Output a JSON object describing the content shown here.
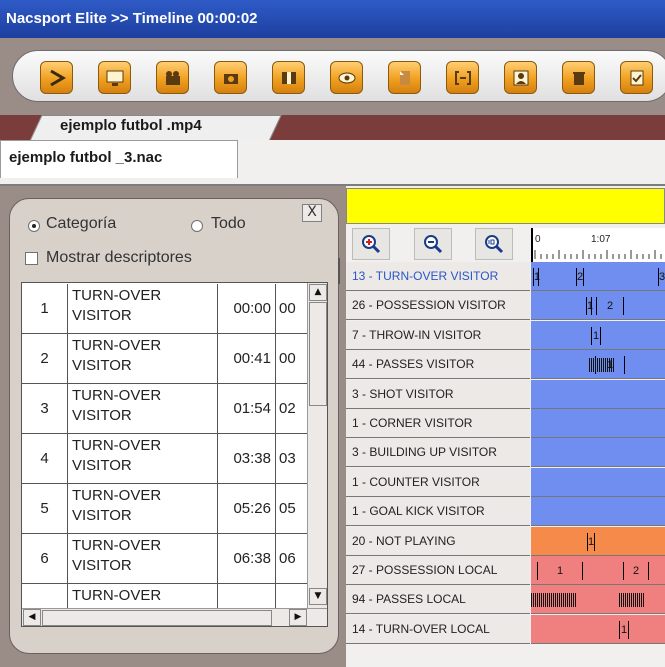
{
  "window": {
    "title": "Nacsport Elite  >>  Timeline 00:00:02"
  },
  "toolbar": {
    "buttons": [
      {
        "icon": "play-arrow-icon"
      },
      {
        "icon": "monitor-icon"
      },
      {
        "icon": "clapperboard-icon"
      },
      {
        "icon": "camera-icon"
      },
      {
        "icon": "film-strip-icon"
      },
      {
        "icon": "eye-icon"
      },
      {
        "icon": "page-icon"
      },
      {
        "icon": "bracket-icon"
      },
      {
        "icon": "image-person-icon"
      },
      {
        "icon": "trash-icon"
      },
      {
        "icon": "check-document-icon"
      }
    ],
    "colors": {
      "button": "#f0a020"
    }
  },
  "tabs": {
    "video": "ejemplo futbol .mp4",
    "project": "ejemplo futbol _3.nac"
  },
  "panel": {
    "close_label": "X",
    "option_category": "Categoría",
    "option_all": "Todo",
    "show_descriptors": "Mostrar descriptores",
    "rows": [
      {
        "num": "1",
        "category": "TURN-OVER VISITOR",
        "start": "00:00",
        "end": "00"
      },
      {
        "num": "2",
        "category": "TURN-OVER VISITOR",
        "start": "00:41",
        "end": "00"
      },
      {
        "num": "3",
        "category": "TURN-OVER VISITOR",
        "start": "01:54",
        "end": "02"
      },
      {
        "num": "4",
        "category": "TURN-OVER VISITOR",
        "start": "03:38",
        "end": "03"
      },
      {
        "num": "5",
        "category": "TURN-OVER VISITOR",
        "start": "05:26",
        "end": "05"
      },
      {
        "num": "6",
        "category": "TURN-OVER VISITOR",
        "start": "06:38",
        "end": "06"
      },
      {
        "num": "",
        "category": "TURN-OVER",
        "start": "",
        "end": ""
      }
    ]
  },
  "timeline": {
    "ruler": {
      "start": "0",
      "mark": "1:07"
    },
    "tracks": [
      {
        "label": "13 - TURN-OVER VISITOR",
        "color": "#6f8ef0",
        "selected": true,
        "markers": [
          {
            "label": "1"
          },
          {
            "label": "2"
          },
          {
            "label": "3"
          }
        ]
      },
      {
        "label": "26 - POSSESSION VISITOR",
        "color": "#6f8ef0",
        "markers": [
          {
            "label": "1"
          },
          {
            "label": "2"
          }
        ]
      },
      {
        "label": "7 - THROW-IN VISITOR",
        "color": "#6f8ef0",
        "markers": [
          {
            "label": "1"
          }
        ]
      },
      {
        "label": "44 - PASSES VISITOR",
        "color": "#6f8ef0",
        "markers": [
          {
            "label": "1"
          }
        ]
      },
      {
        "label": "3 - SHOT VISITOR",
        "color": "#6f8ef0",
        "markers": []
      },
      {
        "label": "1 - CORNER VISITOR",
        "color": "#6f8ef0",
        "markers": []
      },
      {
        "label": "3 - BUILDING UP VISITOR",
        "color": "#6f8ef0",
        "markers": []
      },
      {
        "label": "1 - COUNTER VISITOR",
        "color": "#6f8ef0",
        "markers": []
      },
      {
        "label": "1 - GOAL KICK VISITOR",
        "color": "#6f8ef0",
        "markers": []
      },
      {
        "label": "20 - NOT PLAYING",
        "color": "#f58a4a",
        "markers": [
          {
            "label": "1"
          }
        ]
      },
      {
        "label": "27 - POSSESSION LOCAL",
        "color": "#f08080",
        "markers": [
          {
            "label": "1"
          },
          {
            "label": "2"
          }
        ]
      },
      {
        "label": "94 - PASSES LOCAL",
        "color": "#f08080",
        "markers": []
      },
      {
        "label": "14 - TURN-OVER LOCAL",
        "color": "#f08080",
        "markers": [
          {
            "label": "1"
          }
        ]
      }
    ]
  }
}
